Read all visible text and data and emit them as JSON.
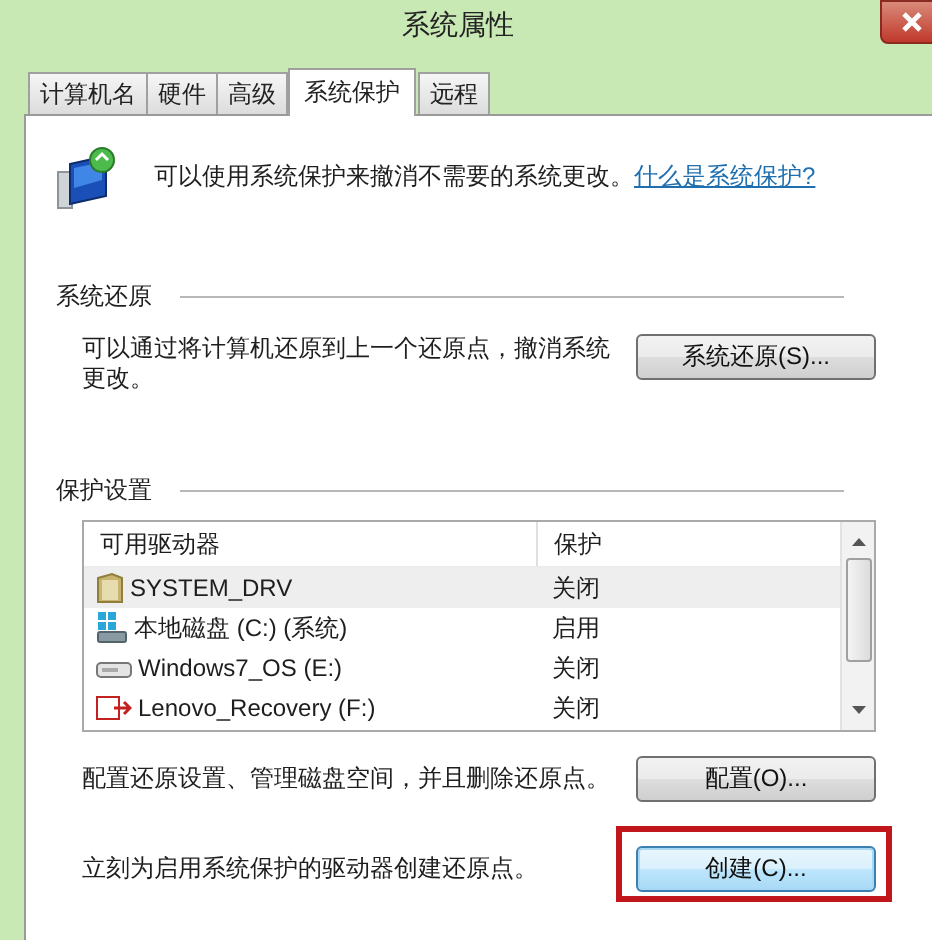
{
  "window": {
    "title": "系统属性"
  },
  "tabs": [
    {
      "label": "计算机名",
      "selected": false
    },
    {
      "label": "硬件",
      "selected": false
    },
    {
      "label": "高级",
      "selected": false
    },
    {
      "label": "系统保护",
      "selected": true
    },
    {
      "label": "远程",
      "selected": false
    }
  ],
  "intro": {
    "text": "可以使用系统保护来撤消不需要的系统更改。",
    "link": "什么是系统保护?"
  },
  "system_restore": {
    "heading": "系统还原",
    "description": "可以通过将计算机还原到上一个还原点，撤消系统更改。",
    "button": "系统还原(S)..."
  },
  "protection_settings": {
    "heading": "保护设置",
    "columns": [
      "可用驱动器",
      "保护"
    ],
    "rows": [
      {
        "drive": "SYSTEM_DRV",
        "protection": "关闭",
        "kind": "folder",
        "selected": true
      },
      {
        "drive": "本地磁盘 (C:) (系统)",
        "protection": "启用",
        "kind": "system",
        "selected": false
      },
      {
        "drive": "Windows7_OS (E:)",
        "protection": "关闭",
        "kind": "disk",
        "selected": false
      },
      {
        "drive": "Lenovo_Recovery (F:)",
        "protection": "关闭",
        "kind": "recovery",
        "selected": false
      }
    ],
    "configure": {
      "description": "配置还原设置、管理磁盘空间，并且删除还原点。",
      "button": "配置(O)..."
    },
    "create": {
      "description": "立刻为启用系统保护的驱动器创建还原点。",
      "button": "创建(C)...",
      "highlighted": true
    }
  }
}
